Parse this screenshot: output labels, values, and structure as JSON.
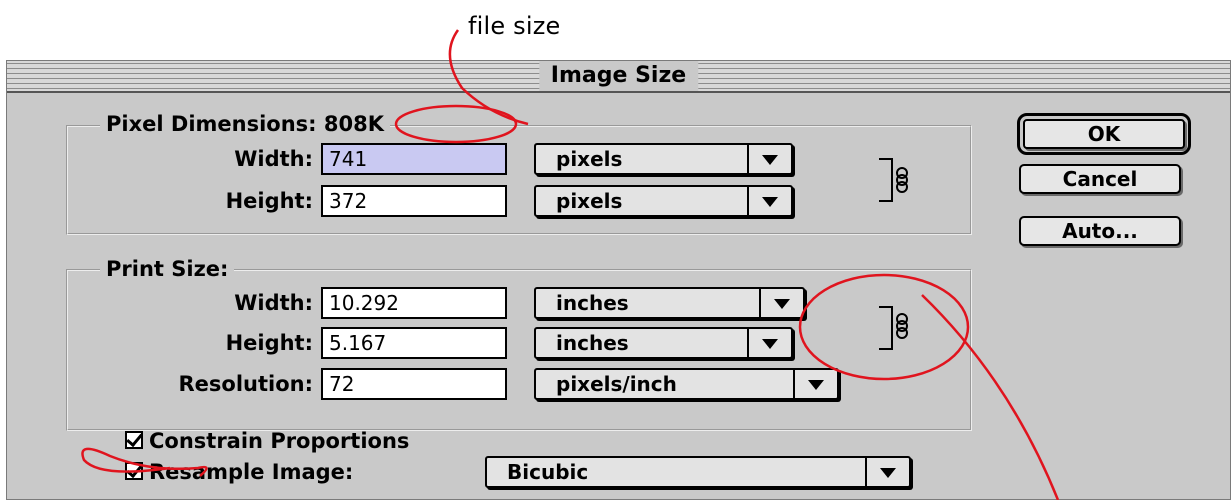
{
  "annotation": {
    "text": "file size"
  },
  "dialog": {
    "title": "Image Size",
    "pixel_dimensions": {
      "title_prefix": "Pixel Dimensions:",
      "file_size": "808K",
      "width_label": "Width:",
      "width_value": "741",
      "width_unit": "pixels",
      "height_label": "Height:",
      "height_value": "372",
      "height_unit": "pixels"
    },
    "print_size": {
      "title": "Print Size:",
      "width_label": "Width:",
      "width_value": "10.292",
      "width_unit": "inches",
      "height_label": "Height:",
      "height_value": "5.167",
      "height_unit": "inches",
      "resolution_label": "Resolution:",
      "resolution_value": "72",
      "resolution_unit": "pixels/inch"
    },
    "options": {
      "constrain_label": "Constrain Proportions",
      "constrain_checked": true,
      "resample_label": "Resample Image:",
      "resample_checked": true,
      "resample_method": "Bicubic"
    },
    "buttons": {
      "ok": "OK",
      "cancel": "Cancel",
      "auto": "Auto..."
    }
  },
  "colors": {
    "dialog_bg": "#c9c9c9",
    "selected_field": "#c9c9f2",
    "annotation_red": "#e0141e"
  },
  "icons": [
    "link-chain-icon",
    "dropdown-arrow-icon",
    "checkmark-icon"
  ]
}
